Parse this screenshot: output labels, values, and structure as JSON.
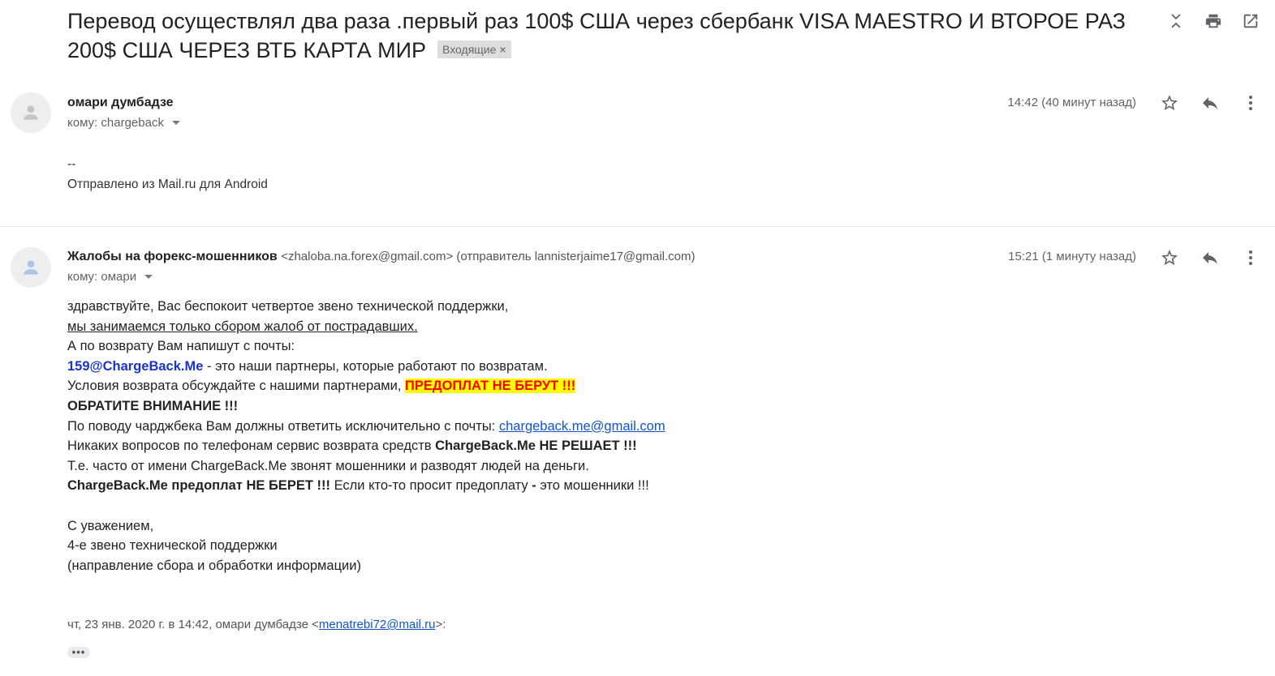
{
  "subject": {
    "text": "Перевод осуществлял два раза .первый раз 100$ США через сбербанк VISA MAESTRO И ВТОРОЕ РАЗ 200$ США ЧЕРЕЗ ВТБ КАРТА МИР",
    "label": "Входящие",
    "label_close": "×"
  },
  "messages": [
    {
      "sender_name": "омари думбадзе",
      "to": "кому: chargeback",
      "time": "14:42 (40 минут назад)",
      "body": {
        "sig_dash": "--",
        "sig_text": "Отправлено из Mail.ru для Android"
      }
    },
    {
      "sender_name": "Жалобы на форекс-мошенников",
      "sender_email": "<zhaloba.na.forex@gmail.com> (отправитель lannisterjaime17@gmail.com)",
      "to": "кому: омари",
      "time": "15:21 (1 минуту назад)",
      "body": {
        "l1": "здравствуйте, Вас беспокоит четвертое звено технической поддержки,",
        "l2": "мы занимаемся только сбором жалоб от пострадавших.",
        "l3": "А по возврату Вам напишут с почты:",
        "l4_email": "159@ChargeBack.Me",
        "l4_rest": " - это наши партнеры, которые работают по возвратам.",
        "l5_text": "Условия возврата обсуждайте с нашими партнерами, ",
        "l5_highlight": "ПРЕДОПЛАТ НЕ БЕРУТ !!!",
        "l6": "ОБРАТИТЕ ВНИМАНИЕ !!!",
        "l7_text": "По поводу чарджбека Вам должны ответить исключительно с почты: ",
        "l7_link": "chargeback.me@gmail.com",
        "l8_text": "Никаких вопросов по телефонам сервис возврата средств ",
        "l8_bold": "ChargeBack.Me НЕ РЕШАЕТ !!!",
        "l9": "Т.е. часто от имени ChargeBack.Me звонят мошенники и разводят людей на деньги.",
        "l10_bold": "ChargeBack.Me предоплат НЕ БЕРЕТ !!!",
        "l10_text": " Если кто-то просит предоплату ",
        "l10_dash": "-",
        "l10_tail": " это мошенники !!!",
        "s1": "С уважением,",
        "s2": "4-е звено технической поддержки",
        "s3": "(направление сбора и обработки информации)",
        "quote_prefix": "чт, 23 янв. 2020 г. в 14:42, омари думбадзе <",
        "quote_link": "menatrebi72@mail.ru",
        "quote_suffix": ">:",
        "ellipsis": "•••"
      }
    }
  ],
  "icons": [
    "expand-collapse-icon",
    "print-icon",
    "open-in-new-window-icon",
    "avatar-person-icon",
    "star-icon",
    "reply-icon",
    "more-vert-icon"
  ],
  "colors": {
    "highlight_bg": "#ffff00",
    "highlight_text": "#ff0000",
    "link": "#1155cc",
    "partner_email": "#1a33cc"
  }
}
